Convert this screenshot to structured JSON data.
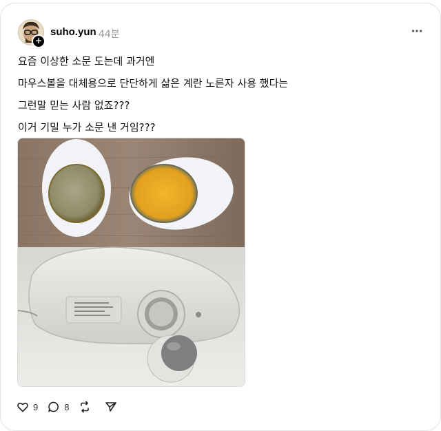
{
  "post": {
    "username": "suho.yun",
    "time": "44분",
    "lines": [
      "요즘 이상한 소문 도는데 과거엔",
      "마우스볼을 대체용으로 단단하게 삶은 계란 노른자 사용 했다는",
      "그런말 믿는 사람 없죠???",
      "이거 기밀 누가 소문 낸 거임???"
    ],
    "avatar_plus": "+"
  },
  "actions": {
    "likes": "9",
    "replies": "8"
  },
  "icons": {
    "more": "more-horizontal-icon",
    "like": "heart-icon",
    "reply": "comment-icon",
    "repost": "repost-icon",
    "share": "send-icon"
  }
}
